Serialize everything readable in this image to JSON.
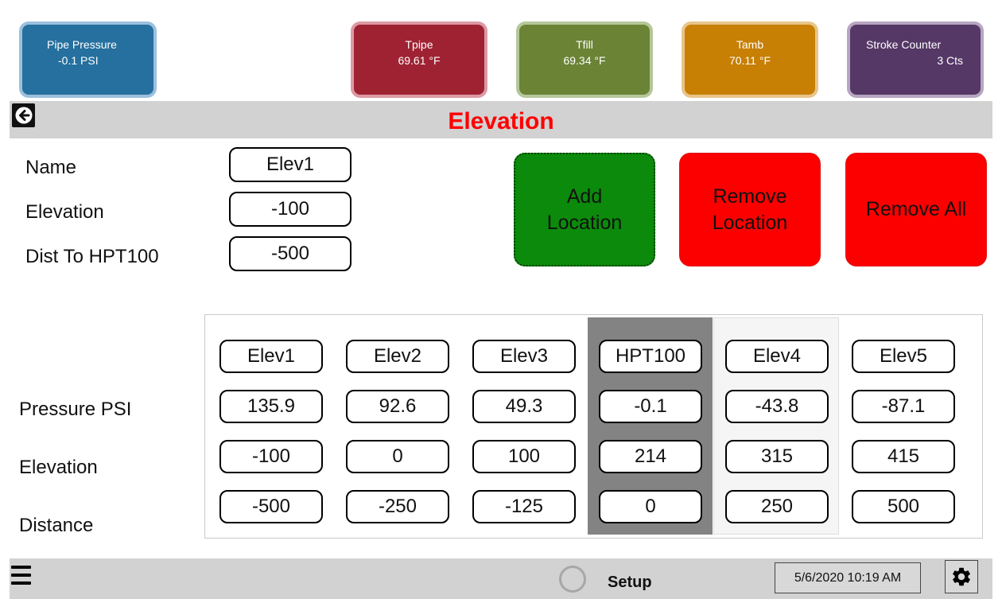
{
  "tiles": {
    "pressure": {
      "label": "Pipe Pressure",
      "value": "-0.1 PSI",
      "color": "#25709e"
    },
    "tpipe": {
      "label": "Tpipe",
      "value": "69.61 °F",
      "color": "#9f2233"
    },
    "tfill": {
      "label": "Tfill",
      "value": "69.34 °F",
      "color": "#6a8335"
    },
    "tamb": {
      "label": "Tamb",
      "value": "70.11 °F",
      "color": "#c77f04"
    },
    "stroke": {
      "label": "Stroke Counter",
      "value": "3 Cts",
      "color": "#553866"
    }
  },
  "header": {
    "title": "Elevation",
    "title_color": "#ff0000",
    "back_icon": "arrow-left-circle-icon"
  },
  "form": {
    "name_label": "Name",
    "name_value": "Elev1",
    "elevation_label": "Elevation",
    "elevation_value": "-100",
    "dist_label": "Dist To HPT100",
    "dist_value": "-500"
  },
  "actions": {
    "add_line1": "Add",
    "add_line2": "Location",
    "remove_line1": "Remove",
    "remove_line2": "Location",
    "remove_all": "Remove All"
  },
  "grid": {
    "row_labels": {
      "pressure": "Pressure  PSI",
      "elevation": "Elevation",
      "distance": "Distance"
    },
    "columns": [
      {
        "name": "Elev1",
        "pressure": "135.9",
        "elevation": "-100",
        "distance": "-500"
      },
      {
        "name": "Elev2",
        "pressure": "92.6",
        "elevation": "0",
        "distance": "-250"
      },
      {
        "name": "Elev3",
        "pressure": "49.3",
        "elevation": "100",
        "distance": "-125"
      },
      {
        "name": "HPT100",
        "pressure": "-0.1",
        "elevation": "214",
        "distance": "0"
      },
      {
        "name": "Elev4",
        "pressure": "-43.8",
        "elevation": "315",
        "distance": "250"
      },
      {
        "name": "Elev5",
        "pressure": "-87.1",
        "elevation": "415",
        "distance": "500"
      }
    ]
  },
  "footer": {
    "menu_icon": "hamburger-menu-icon",
    "status": "Setup",
    "datetime": "5/6/2020 10:19 AM",
    "settings_icon": "gear-icon"
  }
}
